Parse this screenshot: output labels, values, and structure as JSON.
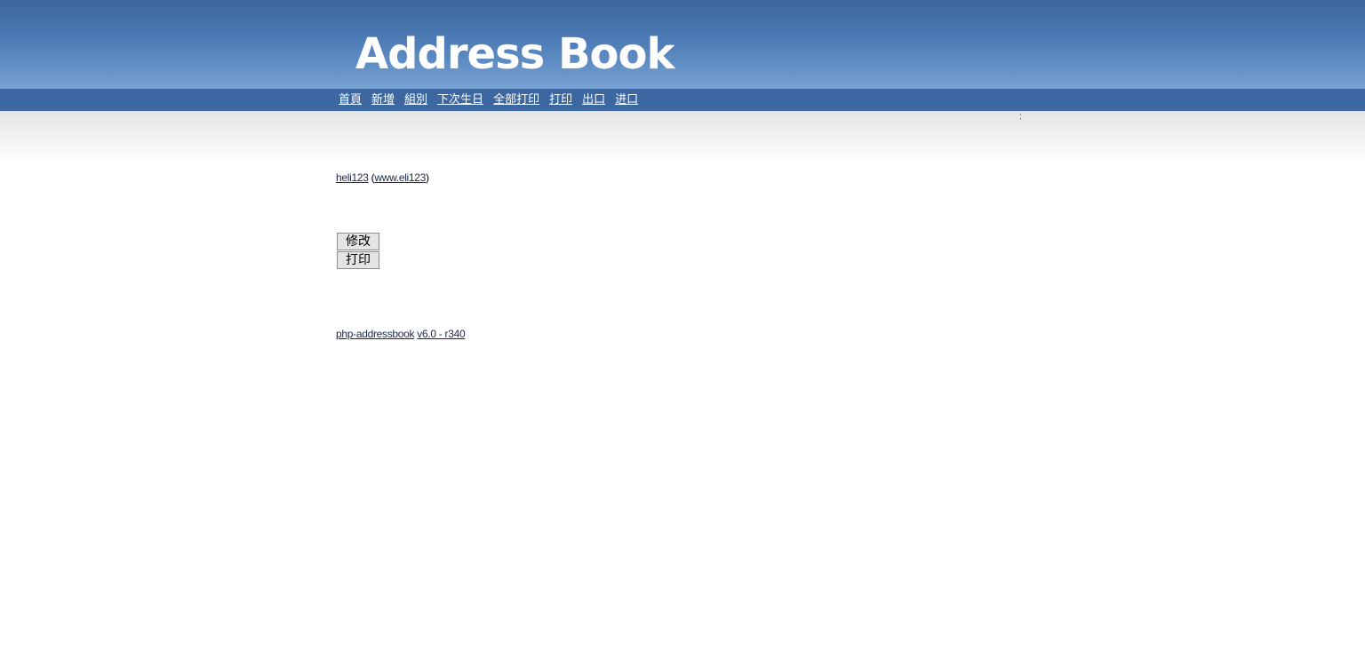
{
  "header": {
    "logo_text": "Address Book"
  },
  "nav": {
    "items": [
      {
        "label": "首頁"
      },
      {
        "label": "新增"
      },
      {
        "label": "組別"
      },
      {
        "label": "下次生日"
      },
      {
        "label": "全部打印"
      },
      {
        "label": "打印"
      },
      {
        "label": "出口"
      },
      {
        "label": "进口"
      }
    ]
  },
  "subbar": {
    "colon": ":"
  },
  "contact": {
    "name": "heli123",
    "open_paren": " (",
    "website": "www.eli123",
    "close_paren": ")"
  },
  "actions": {
    "edit_label": "修改",
    "print_label": "打印"
  },
  "footer": {
    "app_name": "php-addressbook",
    "version": "v6.0 - r340"
  },
  "colors": {
    "header_top": "#3c67a0",
    "header_bottom": "#76a2d4",
    "navbar": "#3d67a1",
    "link": "#1b2a4a"
  }
}
